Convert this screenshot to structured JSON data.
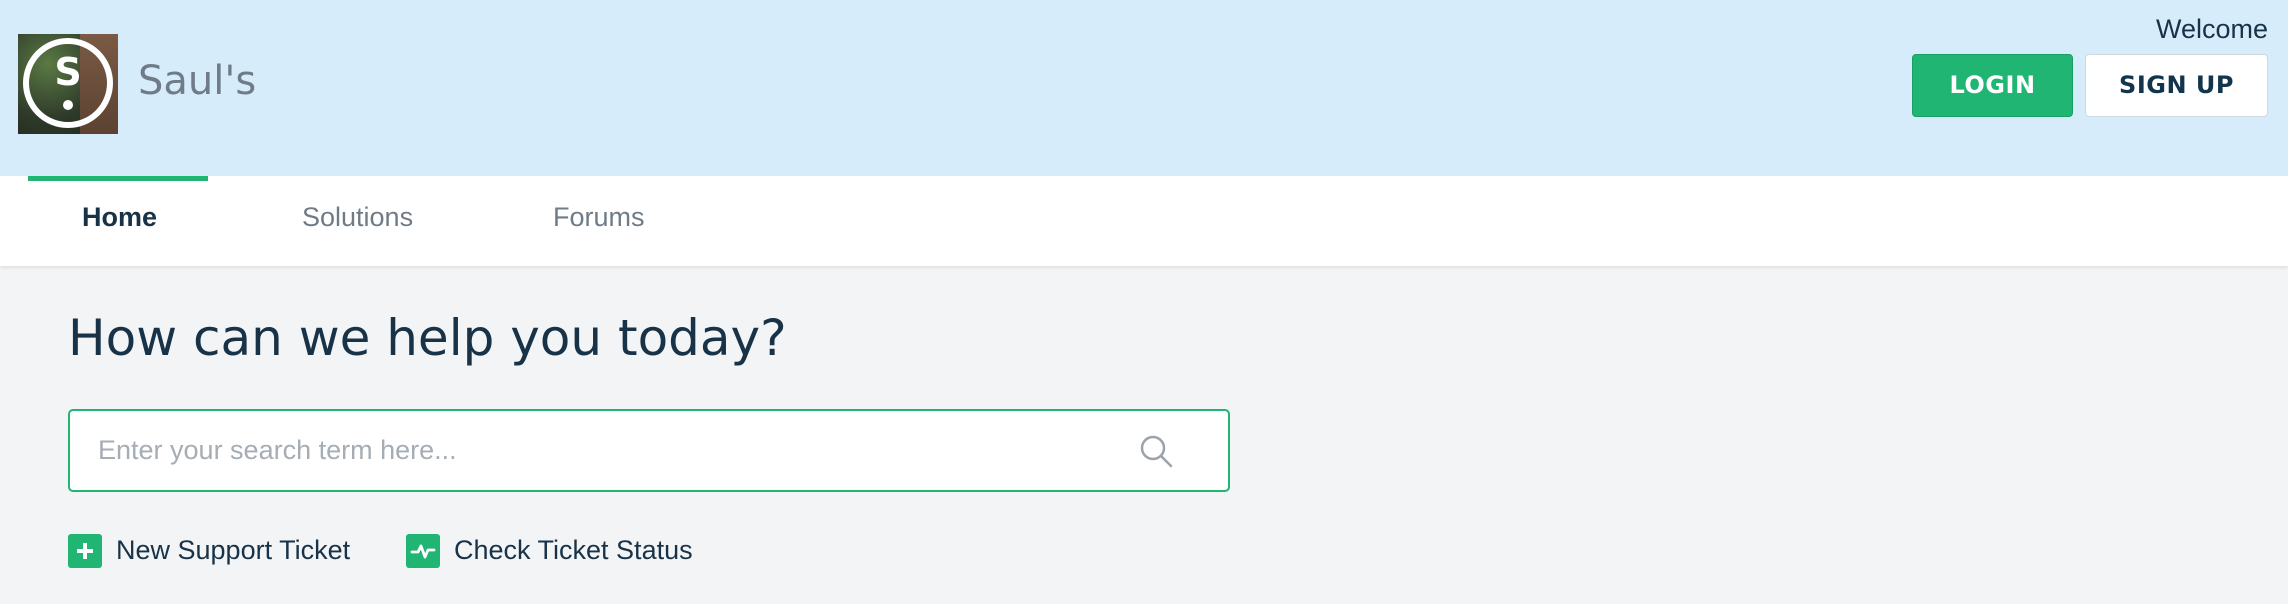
{
  "header": {
    "brand": {
      "name": "Saul's",
      "logo_letter": "S",
      "logo_icon": "logo-icon"
    },
    "welcome": "Welcome",
    "login_label": "LOGIN",
    "signup_label": "SIGN UP",
    "background_color": "#d7ecfb"
  },
  "nav": {
    "items": [
      {
        "label": "Home",
        "active": true
      },
      {
        "label": "Solutions",
        "active": false
      },
      {
        "label": "Forums",
        "active": false
      }
    ]
  },
  "main": {
    "headline": "How can we help you today?",
    "search": {
      "placeholder": "Enter your search term here...",
      "value": "",
      "icon": "search-icon"
    },
    "actions": [
      {
        "label": "New Support Ticket",
        "icon": "plus-icon"
      },
      {
        "label": "Check Ticket Status",
        "icon": "pulse-icon"
      }
    ]
  },
  "colors": {
    "accent": "#21b573",
    "text_primary": "#183247",
    "text_muted": "#6f7c87",
    "page_background": "#f3f4f6"
  }
}
